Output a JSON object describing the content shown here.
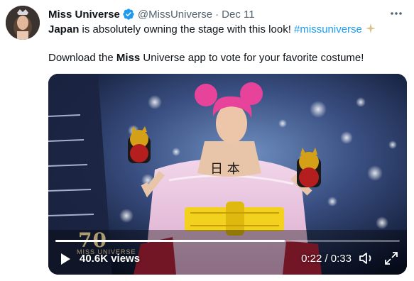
{
  "tweet": {
    "display_name": "Miss Universe",
    "handle": "@MissUniverse",
    "separator": "·",
    "date": "Dec 11",
    "line1": {
      "bold": "Japan",
      "text": " is absolutely owning the stage with this look! ",
      "hashtag": "#missuniverse"
    },
    "line2": {
      "before": "Download the ",
      "bold": "Miss",
      "after": " Universe app to vote for your favorite costume!"
    }
  },
  "video": {
    "views": "40.6K views",
    "time": "0:22 / 0:33",
    "progress": 0.667,
    "logo_number": "70",
    "logo_text": "MISS UNIVERSE"
  },
  "icons": {
    "verified": "verified-badge-icon",
    "more": "more-options-icon",
    "sparkle": "sparkle-emoji-icon",
    "play": "play-icon",
    "volume": "volume-icon",
    "fullscreen": "fullscreen-icon"
  },
  "colors": {
    "link": "#1d9bf0",
    "muted": "#536471",
    "text": "#0f1419",
    "hair": "#e8439a",
    "kimono": "#e9c8e0",
    "obi": "#f2d21e"
  }
}
